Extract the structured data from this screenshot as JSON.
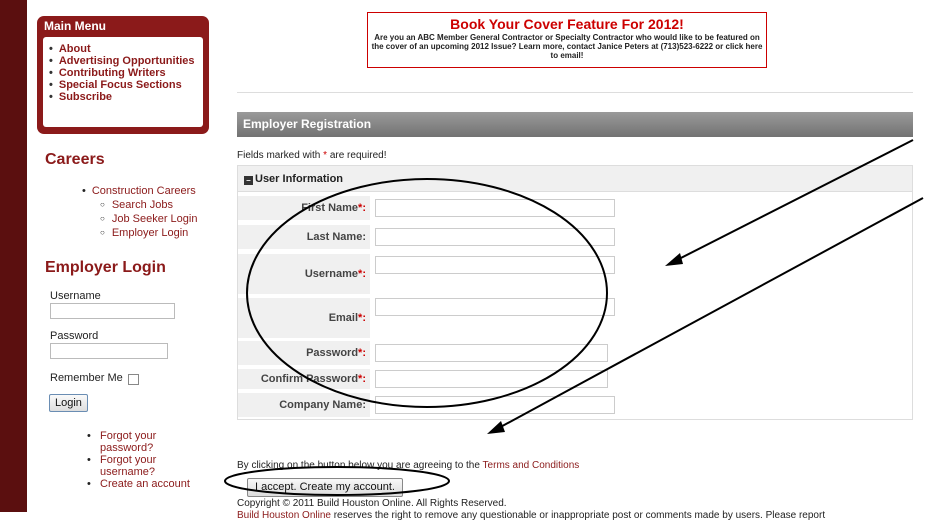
{
  "banner": {
    "title": "Book Your Cover Feature For 2012!",
    "body": "Are you an ABC Member General Contractor or Specialty Contractor who would like to be featured on the cover of an upcoming 2012 Issue? Learn more, contact Janice Peters at (713)523-6222 or click here to email!"
  },
  "main_menu": {
    "title": "Main Menu",
    "items": [
      "About",
      "Advertising Opportunities",
      "Contributing Writers",
      "Special Focus Sections",
      "Subscribe"
    ]
  },
  "careers": {
    "heading": "Careers",
    "top_item": "Construction Careers",
    "sub_items": [
      "Search Jobs",
      "Job Seeker Login",
      "Employer Login"
    ]
  },
  "employer_login": {
    "heading": "Employer Login",
    "username_label": "Username",
    "password_label": "Password",
    "remember_label": "Remember Me",
    "login_button": "Login",
    "links": [
      "Forgot your password?",
      "Forgot your username?",
      "Create an account"
    ]
  },
  "registration": {
    "header": "Employer Registration",
    "required_note_prefix": "Fields marked with ",
    "required_star": "*",
    "required_note_suffix": " are required!",
    "section_title": "User Information",
    "fields": [
      {
        "label": "First Name",
        "required": "*:"
      },
      {
        "label": "Last Name",
        "required": ":"
      },
      {
        "label": "Username",
        "required": "*:"
      },
      {
        "label": "Email",
        "required": "*:"
      },
      {
        "label": "Password",
        "required": "*:"
      },
      {
        "label": "Confirm Password",
        "required": "*:"
      },
      {
        "label": "Company Name",
        "required": ":"
      }
    ],
    "terms_prefix": "By clicking on the button below you are agreeing to the ",
    "terms_link": "Terms and Conditions",
    "create_button": "I accept. Create my account."
  },
  "footer": {
    "copyright": "Copyright © 2011 Build Houston Online. All Rights Reserved.",
    "disclaimer_link": "Build Houston Online",
    "disclaimer_text": " reserves the right to remove any questionable or inappropriate post or comments made by users. Please report"
  }
}
